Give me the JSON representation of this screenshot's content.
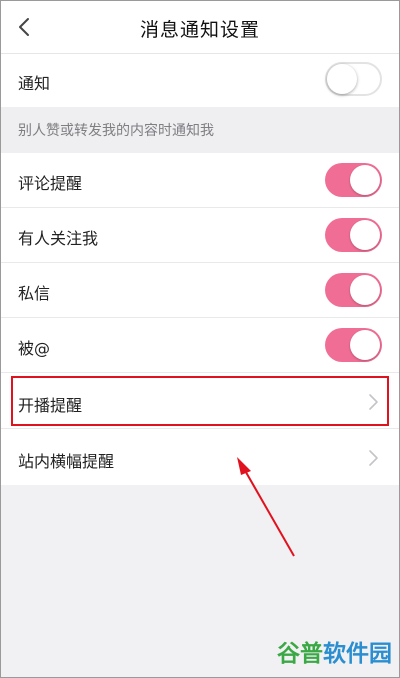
{
  "header": {
    "title": "消息通知设置",
    "back_icon": "chevron-left-icon"
  },
  "notification_row": {
    "label": "通知",
    "enabled": false
  },
  "section": {
    "header": "别人赞或转发我的内容时通知我"
  },
  "toggle_items": [
    {
      "label": "评论提醒",
      "enabled": true
    },
    {
      "label": "有人关注我",
      "enabled": true
    },
    {
      "label": "私信",
      "enabled": true
    },
    {
      "label": "被@",
      "enabled": true
    }
  ],
  "nav_items": [
    {
      "label": "开播提醒",
      "icon": "chevron-right-icon",
      "highlighted": true
    },
    {
      "label": "站内横幅提醒",
      "icon": "chevron-right-icon",
      "highlighted": false
    }
  ],
  "annotation": {
    "box_color": "#e1121f",
    "arrow_color": "#e1121f"
  },
  "colors": {
    "toggle_on": "#f06e95",
    "background": "#f1f1f3",
    "row_background": "#ffffff"
  },
  "watermark": {
    "part1": "谷普",
    "part2": "软件园"
  }
}
